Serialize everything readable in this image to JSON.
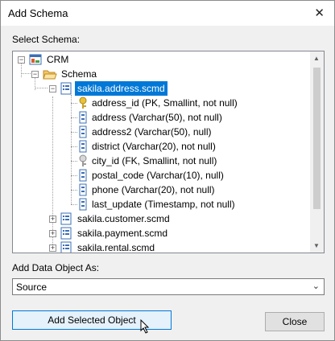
{
  "window": {
    "title": "Add Schema",
    "close_glyph": "✕"
  },
  "select_schema_label": "Select Schema:",
  "tree": {
    "root": {
      "label": "CRM",
      "icon": "database-icon"
    },
    "schema_folder": {
      "label": "Schema",
      "icon": "folder-open-icon"
    },
    "selected_file": {
      "label": "sakila.address.scmd",
      "icon": "schema-file-icon"
    },
    "fields": [
      {
        "label": "address_id (PK, Smallint, not null)",
        "icon": "key-icon"
      },
      {
        "label": "address (Varchar(50), not null)",
        "icon": "column-icon"
      },
      {
        "label": "address2 (Varchar(50), null)",
        "icon": "column-icon"
      },
      {
        "label": "district (Varchar(20), not null)",
        "icon": "column-icon"
      },
      {
        "label": "city_id (FK, Smallint, not null)",
        "icon": "key-icon"
      },
      {
        "label": "postal_code (Varchar(10), null)",
        "icon": "column-icon"
      },
      {
        "label": "phone (Varchar(20), not null)",
        "icon": "column-icon"
      },
      {
        "label": "last_update (Timestamp, not null)",
        "icon": "column-icon"
      }
    ],
    "other_files": [
      {
        "label": "sakila.customer.scmd"
      },
      {
        "label": "sakila.payment.scmd"
      },
      {
        "label": "sakila.rental.scmd"
      }
    ]
  },
  "add_as_label": "Add Data Object As:",
  "add_as_select": {
    "value": "Source"
  },
  "buttons": {
    "add_selected": "Add Selected Object",
    "close": "Close"
  },
  "colors": {
    "selection": "#0078d7",
    "primary_border": "#0078d7"
  }
}
